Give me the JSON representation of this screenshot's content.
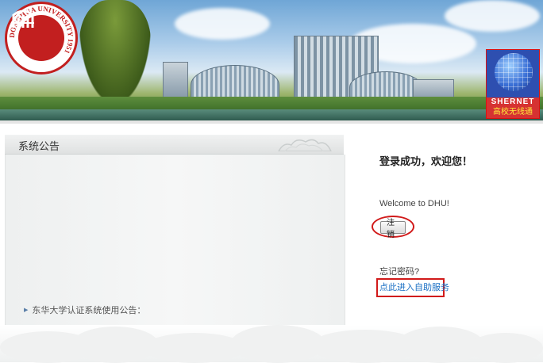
{
  "banner": {
    "logo_text": "DONGHUA UNIVERSITY 1951",
    "partner_brand": "SHERNET",
    "partner_sub": "高校无线通"
  },
  "notice": {
    "title": "系统公告",
    "items": [
      {
        "label": "东华大学认证系统使用公告："
      }
    ]
  },
  "login": {
    "success_message": "登录成功，欢迎您！",
    "welcome_text": "Welcome to DHU!",
    "logout_label": "注销",
    "forgot_label": "忘记密码?",
    "self_service_link": "点此进入自助服务"
  },
  "colors": {
    "highlight_border": "#d11a1a",
    "link": "#1a6fc4",
    "logo_red": "#c21f1f"
  },
  "icons": {
    "notice_bullet": "triangle-right-icon",
    "header_decoration": "cloud-icon"
  }
}
